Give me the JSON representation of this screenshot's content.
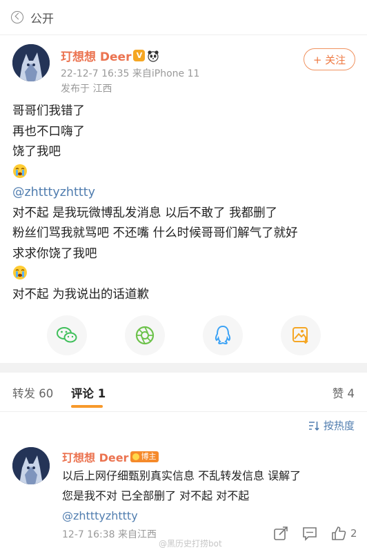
{
  "topbar": {
    "title": "公开"
  },
  "post": {
    "author": "玎想想 Deer",
    "time_device": "22-12-7 16:35  来自iPhone 11",
    "location": "发布于 江西",
    "follow_label": "+ 关注",
    "lines": [
      "哥哥们我错了",
      "再也不口嗨了",
      "饶了我吧",
      "@zhtttyzhttty",
      "对不起  是我玩微博乱发消息 以后不敢了 我都删了",
      "粉丝们骂我就骂吧 不还嘴 什么时候哥哥们解气了就好",
      "求求你饶了我吧",
      "对不起  为我说出的话道歉"
    ]
  },
  "tabs": {
    "repost": "转发 60",
    "comment": "评论 1",
    "like": "赞 4"
  },
  "sort": {
    "label": "按热度"
  },
  "comment": {
    "author": "玎想想 Deer",
    "badge": "博主",
    "lines": [
      "以后上网仔细甄别真实信息 不乱转发信息  误解了",
      "您是我不对 已全部删了 对不起 对不起",
      "@zhtttyzhttty"
    ],
    "time_location": "12-7 16:38  来自江西",
    "like_count": "2"
  },
  "watermark": "@黑历史打捞bot",
  "colors": {
    "username": "#eb7350",
    "mention": "#507daf",
    "accent": "#f7992b",
    "wechat": "#3fbf5a",
    "moments": "#6cc24a",
    "qq": "#3ba2f5",
    "album": "#f5a623"
  },
  "icons": [
    "back-icon",
    "wechat-icon",
    "moments-icon",
    "qq-icon",
    "album-icon",
    "sort-icon",
    "share-icon",
    "comment-icon",
    "like-icon"
  ]
}
